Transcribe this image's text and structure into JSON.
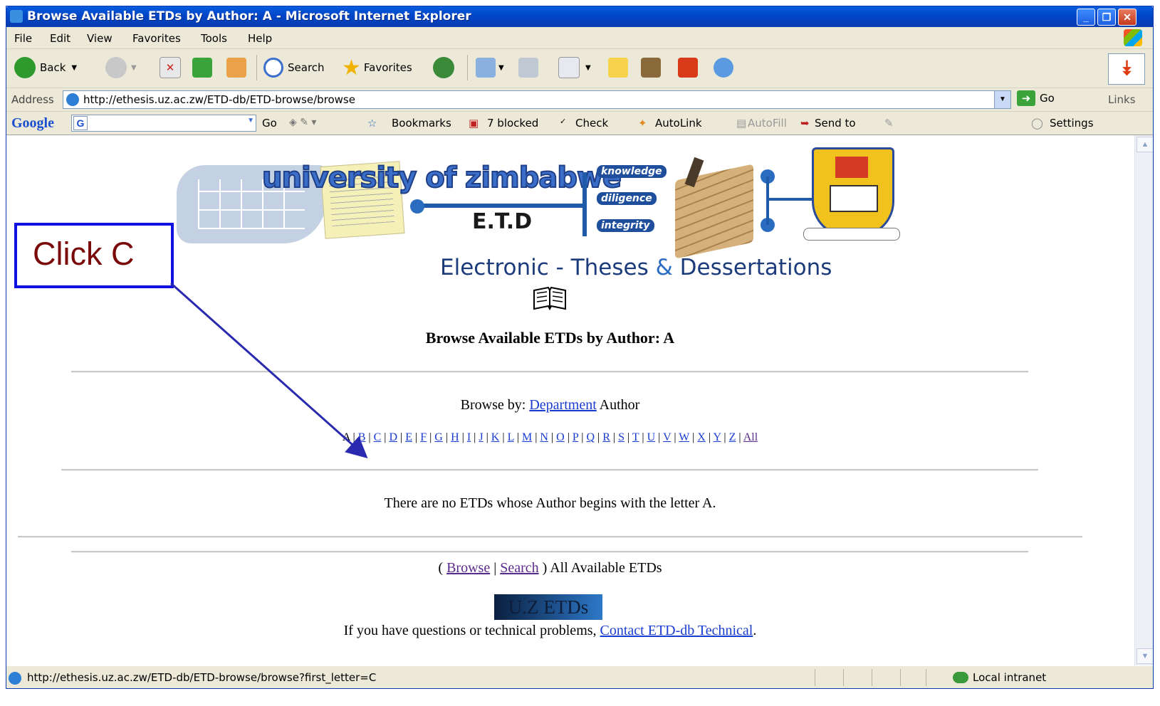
{
  "window": {
    "title": "Browse Available ETDs by Author: A - Microsoft Internet Explorer",
    "buttons": {
      "minimize": "_",
      "maximize": "❐",
      "close": "✕"
    }
  },
  "menu": [
    "File",
    "Edit",
    "View",
    "Favorites",
    "Tools",
    "Help"
  ],
  "toolbar": {
    "back": "Back",
    "search": "Search",
    "favorites": "Favorites"
  },
  "address": {
    "label": "Address",
    "url": "http://ethesis.uz.ac.zw/ETD-db/ETD-browse/browse",
    "go": "Go",
    "links": "Links"
  },
  "googlebar": {
    "logo": "Google",
    "go": "Go",
    "bookmarks": "Bookmarks",
    "blocked": "7 blocked",
    "check": "Check",
    "autolink": "AutoLink",
    "autofill": "AutoFill",
    "sendto": "Send to",
    "settings": "Settings"
  },
  "banner": {
    "university": "university of zimbabwe",
    "etd": "E.T.D",
    "keywords": [
      "knowledge",
      "diligence",
      "integrity"
    ],
    "subtitle_part1": "Electronic",
    "subtitle_dash": " - ",
    "subtitle_part2": "Theses",
    "subtitle_amp": " & ",
    "subtitle_part3": "Dessertations"
  },
  "page": {
    "heading": "Browse Available ETDs by Author: A",
    "browse_by_label": "Browse by:",
    "browse_by_department": "Department",
    "browse_by_author": "Author",
    "current_letter": "A",
    "letters": [
      "B",
      "C",
      "D",
      "E",
      "F",
      "G",
      "H",
      "I",
      "J",
      "K",
      "L",
      "M",
      "N",
      "O",
      "P",
      "Q",
      "R",
      "S",
      "T",
      "U",
      "V",
      "W",
      "X",
      "Y",
      "Z",
      "All"
    ],
    "no_results": "There are no ETDs whose Author begins with the letter A.",
    "footer_open": "( ",
    "footer_browse": "Browse",
    "footer_sep": " | ",
    "footer_search": "Search",
    "footer_close": " ) All Available ETDs",
    "logo_text": "U.Z ETDs",
    "contact_prefix": "If you have questions or technical problems, ",
    "contact_link": "Contact ETD-db Technical",
    "contact_suffix": "."
  },
  "annotation": {
    "label": "Click C"
  },
  "status": {
    "text": "http://ethesis.uz.ac.zw/ETD-db/ETD-browse/browse?first_letter=C",
    "zone": "Local intranet"
  }
}
